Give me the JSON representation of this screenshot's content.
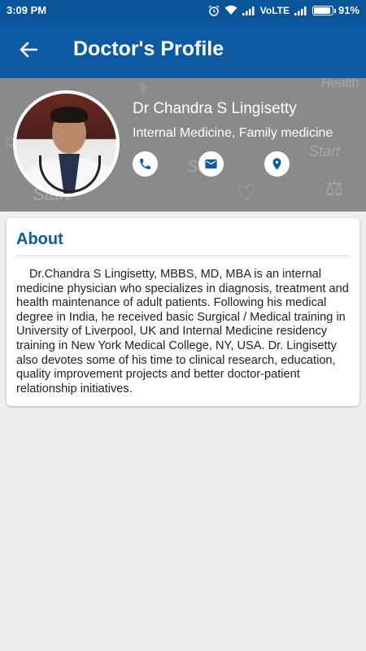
{
  "status_bar": {
    "time": "3:09 PM",
    "network": "VoLTE",
    "battery": "91%",
    "battery_level": 0.91,
    "icons": [
      "alarm-icon",
      "wifi-icon",
      "signal-icon",
      "signal-icon",
      "battery-icon"
    ]
  },
  "app_bar": {
    "title": "Doctor's Profile",
    "back_icon": "arrow-back-icon"
  },
  "profile": {
    "name": "Dr Chandra S Lingisetty",
    "specialty": "Internal Medicine, Family medicine",
    "actions": [
      "phone-icon",
      "email-icon",
      "location-icon"
    ]
  },
  "about": {
    "heading": "About",
    "body": "Dr.Chandra S Lingisetty, MBBS, MD, MBA is an internal medicine physician who specializes in diagnosis, treatment and health maintenance of adult patients. Following his medical degree in India, he received basic Surgical / Medical training in University of Liverpool, UK and Internal Medicine residency training in New York Medical College, NY, USA. Dr. Lingisetty also devotes some of his time to clinical research, education, quality improvement projects and better doctor-patient relationship initiatives."
  },
  "colors": {
    "primary": "#0d5aa3",
    "status_bar": "#0a5499",
    "header_bg": "#8a8a8a",
    "background": "#eeeeee"
  }
}
